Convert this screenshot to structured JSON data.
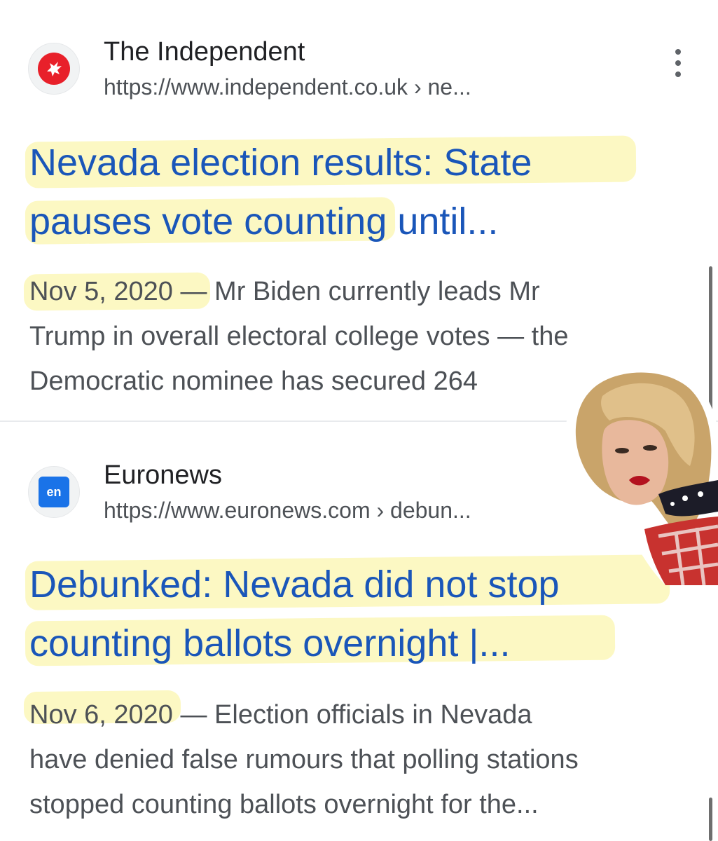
{
  "results": [
    {
      "site_name": "The Independent",
      "url": "https://www.independent.co.uk",
      "breadcrumb": " › ne...",
      "favicon_icon": "eagle-icon",
      "favicon_color": "#e8202a",
      "title_line1": "Nevada election results: State",
      "title_line2": "pauses vote counting until...",
      "date": "Nov 5, 2020",
      "snippet_line1": " — Mr Biden currently leads Mr",
      "snippet_line2": "Trump in overall electoral college votes — the",
      "snippet_line3": "Democratic nominee has secured 264"
    },
    {
      "site_name": "Euronews",
      "url": "https://www.euronews.com",
      "breadcrumb": " › debun...",
      "favicon_text": "en",
      "favicon_color": "#1a73e8",
      "title_line1": "Debunked: Nevada did not stop",
      "title_line2": "counting ballots overnight |...",
      "date": "Nov 6, 2020",
      "snippet_line1": " — Election officials in Nevada",
      "snippet_line2": "have denied false rumours that polling stations",
      "snippet_line3": "stopped counting ballots overnight for the..."
    }
  ],
  "colors": {
    "link": "#1a56b9",
    "highlight": "#fcf7b8",
    "text": "#4d5156"
  }
}
